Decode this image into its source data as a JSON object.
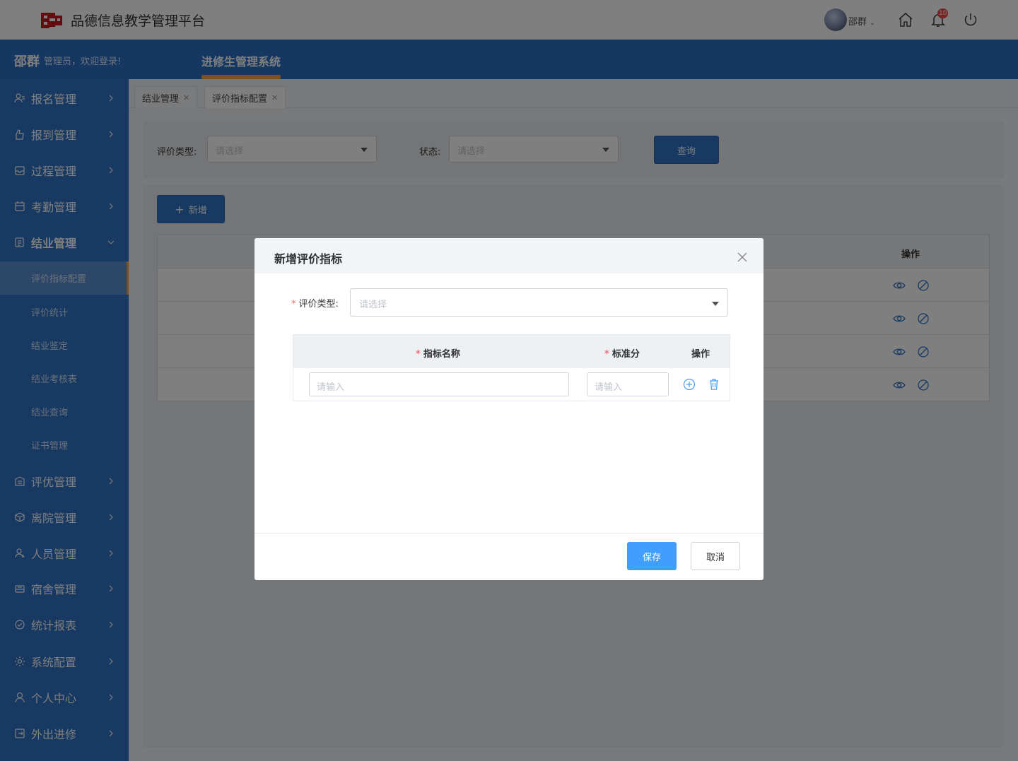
{
  "header": {
    "app_title": "品德信息教学管理平台",
    "user_name": "邵群",
    "notification_count": "10"
  },
  "banner": {
    "welcome_name": "邵群",
    "welcome_text": "管理员，欢迎登录!",
    "system_name": "进修生管理系统"
  },
  "sidebar": {
    "items": [
      {
        "label": "报名管理",
        "icon": "user-list-icon"
      },
      {
        "label": "报到管理",
        "icon": "hand-icon"
      },
      {
        "label": "过程管理",
        "icon": "inbox-icon"
      },
      {
        "label": "考勤管理",
        "icon": "calendar-icon"
      },
      {
        "label": "结业管理",
        "icon": "document-icon"
      },
      {
        "label": "评优管理",
        "icon": "building-icon"
      },
      {
        "label": "离院管理",
        "icon": "box-icon"
      },
      {
        "label": "人员管理",
        "icon": "person-icon"
      },
      {
        "label": "宿舍管理",
        "icon": "bed-icon"
      },
      {
        "label": "统计报表",
        "icon": "check-circle-icon"
      },
      {
        "label": "系统配置",
        "icon": "settings-icon"
      },
      {
        "label": "个人中心",
        "icon": "profile-icon"
      },
      {
        "label": "外出进修",
        "icon": "exit-icon"
      }
    ],
    "sub_items": [
      "评价指标配置",
      "评价统计",
      "结业鉴定",
      "结业考核表",
      "结业查询",
      "证书管理"
    ],
    "active_sub": "评价指标配置"
  },
  "tabs": [
    {
      "label": "结业管理"
    },
    {
      "label": "评价指标配置"
    }
  ],
  "filter": {
    "type_label": "评价类型:",
    "type_placeholder": "请选择",
    "status_label": "状态:",
    "status_placeholder": "请选择",
    "query_button": "查询"
  },
  "list": {
    "add_button": "新增",
    "ops_header": "操作"
  },
  "dialog": {
    "title": "新增评价指标",
    "type_label": "评价类型:",
    "type_placeholder": "请选择",
    "col_name": "指标名称",
    "col_score": "标准分",
    "col_ops": "操作",
    "name_placeholder": "请输入",
    "score_placeholder": "请输入",
    "save_button": "保存",
    "cancel_button": "取消"
  },
  "colors": {
    "brand_blue": "#2f72c4",
    "accent_orange": "#f3a43b",
    "save_blue": "#409eff"
  }
}
